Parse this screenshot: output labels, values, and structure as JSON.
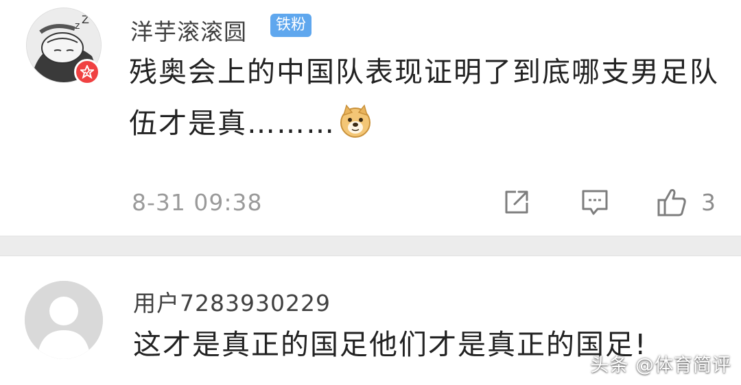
{
  "comments": [
    {
      "username": "洋芋滚滚圆",
      "tag": "铁粉",
      "text": "残奥会上的中国队表现证明了到底哪支男足队伍才是真………",
      "emoji": "doge-emoji",
      "time": "8-31 09:38",
      "likes": "3",
      "verified": true
    },
    {
      "username": "用户7283930229",
      "text": "这才是真正的国足他们才是真正的国足!"
    }
  ],
  "watermark": "头条 @体育简评",
  "colors": {
    "tag_bg": "#5fa7ee",
    "verified_badge": "#f04142",
    "divider": "#ececec",
    "meta_gray": "#9a9a9a"
  },
  "icons": [
    "share-icon",
    "reply-icon",
    "thumbs-up-icon",
    "verified-badge-icon"
  ]
}
